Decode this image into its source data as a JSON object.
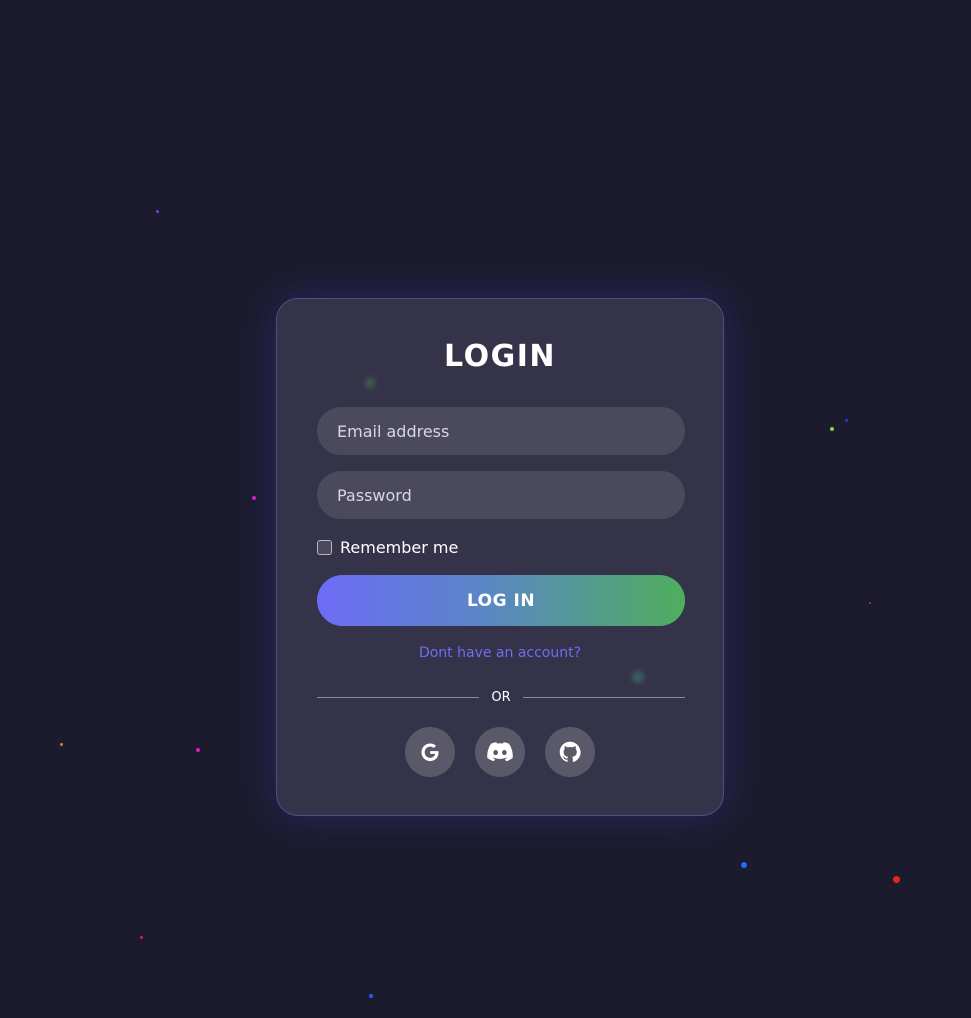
{
  "login_form": {
    "title": "LOGIN",
    "email_placeholder": "Email address",
    "password_placeholder": "Password",
    "remember_label": "Remember me",
    "remember_checked": false,
    "submit_label": "LOG IN",
    "signup_link": "Dont have an account?",
    "divider_text": "OR",
    "social_providers": [
      {
        "name": "google",
        "icon": "google-icon"
      },
      {
        "name": "discord",
        "icon": "discord-icon"
      },
      {
        "name": "github",
        "icon": "github-icon"
      }
    ]
  },
  "colors": {
    "background": "#1c1b2e",
    "card": "#34334a",
    "field": "#4b4a5d",
    "link": "#6f6df0",
    "gradient_start": "#6d6cf7",
    "gradient_end": "#4fae5d"
  }
}
